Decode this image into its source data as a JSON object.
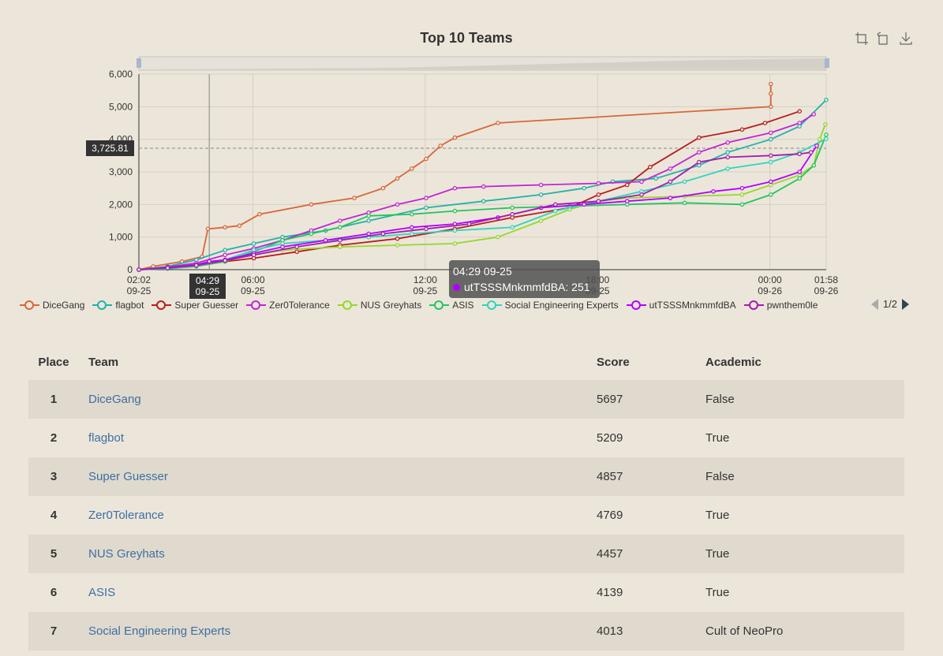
{
  "chart_data": {
    "type": "line",
    "title": "Top 10 Teams",
    "xlabel": "",
    "ylabel": "",
    "ylim": [
      0,
      6000
    ],
    "yticks": [
      "0",
      "1,000",
      "2,000",
      "3,000",
      "4,000",
      "5,000",
      "6,000"
    ],
    "xticks": [
      {
        "time": "02:02",
        "date": "09-25"
      },
      {
        "time": "06:00",
        "date": "09-25"
      },
      {
        "time": "12:00",
        "date": "09-25"
      },
      {
        "time": "18:00",
        "date": "09-25"
      },
      {
        "time": "00:00",
        "date": "09-26"
      },
      {
        "time": "01:58",
        "date": "09-26"
      }
    ],
    "xrange_hours": [
      0,
      23.93
    ],
    "grid": true,
    "legend_position": "bottom",
    "legend_page": "1/2",
    "crosshair": {
      "y_label": "3,725.81",
      "x_label_time": "04:29",
      "x_label_date": "09-25"
    },
    "tooltip": {
      "header": "04:29 09-25",
      "series": "utTSSSMnkmmfdBA",
      "value": "251"
    },
    "series": [
      {
        "name": "DiceGang",
        "color": "#d9663a",
        "points": [
          [
            0,
            0
          ],
          [
            0.5,
            100
          ],
          [
            1.5,
            250
          ],
          [
            2.2,
            400
          ],
          [
            2.4,
            1250
          ],
          [
            3,
            1300
          ],
          [
            3.5,
            1350
          ],
          [
            4.2,
            1700
          ],
          [
            6,
            2000
          ],
          [
            7.5,
            2200
          ],
          [
            8.5,
            2500
          ],
          [
            9,
            2800
          ],
          [
            9.5,
            3100
          ],
          [
            10,
            3400
          ],
          [
            10.5,
            3800
          ],
          [
            11,
            4050
          ],
          [
            12.5,
            4500
          ],
          [
            22,
            5000
          ],
          [
            22,
            5400
          ],
          [
            22,
            5697
          ]
        ]
      },
      {
        "name": "flagbot",
        "color": "#20b2aa",
        "points": [
          [
            0,
            0
          ],
          [
            1,
            100
          ],
          [
            2,
            300
          ],
          [
            3,
            600
          ],
          [
            4,
            800
          ],
          [
            5,
            1000
          ],
          [
            6.5,
            1200
          ],
          [
            8,
            1500
          ],
          [
            10,
            1900
          ],
          [
            12,
            2100
          ],
          [
            14,
            2300
          ],
          [
            15.5,
            2500
          ],
          [
            16.5,
            2700
          ],
          [
            18,
            2800
          ],
          [
            19.5,
            3200
          ],
          [
            20.5,
            3600
          ],
          [
            22,
            4000
          ],
          [
            23,
            4400
          ],
          [
            23.93,
            5209
          ]
        ]
      },
      {
        "name": "Super Guesser",
        "color": "#b91c1c",
        "points": [
          [
            0,
            0
          ],
          [
            1,
            50
          ],
          [
            2,
            150
          ],
          [
            3,
            250
          ],
          [
            4,
            350
          ],
          [
            5.5,
            550
          ],
          [
            7,
            750
          ],
          [
            9,
            950
          ],
          [
            11,
            1250
          ],
          [
            13,
            1600
          ],
          [
            15,
            1900
          ],
          [
            16,
            2300
          ],
          [
            17,
            2600
          ],
          [
            17.8,
            3150
          ],
          [
            19.5,
            4050
          ],
          [
            21,
            4300
          ],
          [
            21.8,
            4500
          ],
          [
            23,
            4857
          ]
        ]
      },
      {
        "name": "Zer0Tolerance",
        "color": "#c026d3",
        "points": [
          [
            0,
            0
          ],
          [
            1,
            80
          ],
          [
            2,
            200
          ],
          [
            3,
            450
          ],
          [
            4,
            650
          ],
          [
            5,
            900
          ],
          [
            6,
            1200
          ],
          [
            7,
            1500
          ],
          [
            8,
            1750
          ],
          [
            9,
            2000
          ],
          [
            10,
            2200
          ],
          [
            11,
            2500
          ],
          [
            12,
            2550
          ],
          [
            14,
            2600
          ],
          [
            16,
            2650
          ],
          [
            17.5,
            2700
          ],
          [
            18.5,
            3100
          ],
          [
            19.5,
            3600
          ],
          [
            20.5,
            3900
          ],
          [
            22,
            4200
          ],
          [
            23,
            4500
          ],
          [
            23.5,
            4769
          ]
        ]
      },
      {
        "name": "NUS Greyhats",
        "color": "#94d82d",
        "points": [
          [
            0,
            0
          ],
          [
            1,
            50
          ],
          [
            2,
            150
          ],
          [
            3,
            300
          ],
          [
            4,
            450
          ],
          [
            5,
            600
          ],
          [
            7,
            700
          ],
          [
            9,
            750
          ],
          [
            11,
            800
          ],
          [
            12.5,
            1000
          ],
          [
            14,
            1500
          ],
          [
            15,
            1850
          ],
          [
            16,
            2100
          ],
          [
            17,
            2200
          ],
          [
            19,
            2250
          ],
          [
            21,
            2300
          ],
          [
            22,
            2600
          ],
          [
            23,
            2900
          ],
          [
            23.5,
            3200
          ],
          [
            23.7,
            4000
          ],
          [
            23.9,
            4457
          ]
        ]
      },
      {
        "name": "ASIS",
        "color": "#22c55e",
        "points": [
          [
            0,
            0
          ],
          [
            1,
            30
          ],
          [
            2,
            100
          ],
          [
            3,
            250
          ],
          [
            4,
            550
          ],
          [
            5,
            900
          ],
          [
            6,
            1100
          ],
          [
            7,
            1300
          ],
          [
            8,
            1650
          ],
          [
            9.5,
            1700
          ],
          [
            11,
            1800
          ],
          [
            13,
            1900
          ],
          [
            15,
            1950
          ],
          [
            17,
            2000
          ],
          [
            19,
            2050
          ],
          [
            21,
            2000
          ],
          [
            22,
            2300
          ],
          [
            23,
            2800
          ],
          [
            23.5,
            3200
          ],
          [
            23.93,
            4139
          ]
        ]
      },
      {
        "name": "Social Engineering Experts",
        "color": "#2dd4bf",
        "points": [
          [
            0,
            0
          ],
          [
            1,
            40
          ],
          [
            2,
            120
          ],
          [
            3,
            300
          ],
          [
            4,
            600
          ],
          [
            5,
            800
          ],
          [
            6.5,
            900
          ],
          [
            8,
            1000
          ],
          [
            9.5,
            1100
          ],
          [
            11,
            1200
          ],
          [
            13,
            1300
          ],
          [
            14.5,
            1800
          ],
          [
            16,
            2100
          ],
          [
            17.5,
            2400
          ],
          [
            19,
            2700
          ],
          [
            20.5,
            3100
          ],
          [
            22,
            3300
          ],
          [
            23,
            3600
          ],
          [
            23.93,
            4013
          ]
        ]
      },
      {
        "name": "utTSSSMnkmmfdBA",
        "color": "#b400ff",
        "points": [
          [
            0,
            0
          ],
          [
            1,
            60
          ],
          [
            2,
            150
          ],
          [
            2.45,
            251
          ],
          [
            3,
            300
          ],
          [
            4,
            500
          ],
          [
            5,
            700
          ],
          [
            6.5,
            900
          ],
          [
            8,
            1100
          ],
          [
            9.5,
            1300
          ],
          [
            11,
            1400
          ],
          [
            12.5,
            1600
          ],
          [
            14,
            1900
          ],
          [
            15.5,
            2000
          ],
          [
            17,
            2100
          ],
          [
            18.5,
            2200
          ],
          [
            20,
            2400
          ],
          [
            21,
            2500
          ],
          [
            22,
            2700
          ],
          [
            23,
            3000
          ],
          [
            23.6,
            3800
          ]
        ]
      },
      {
        "name": "pwnthem0le",
        "color": "#a21caf",
        "points": [
          [
            0,
            0
          ],
          [
            1,
            50
          ],
          [
            2,
            130
          ],
          [
            3,
            280
          ],
          [
            4,
            450
          ],
          [
            5.5,
            700
          ],
          [
            7,
            900
          ],
          [
            8.5,
            1100
          ],
          [
            10,
            1250
          ],
          [
            11.5,
            1400
          ],
          [
            13,
            1700
          ],
          [
            14.5,
            2000
          ],
          [
            16,
            2100
          ],
          [
            17.5,
            2300
          ],
          [
            18.5,
            2700
          ],
          [
            19.5,
            3300
          ],
          [
            20.5,
            3450
          ],
          [
            22,
            3500
          ],
          [
            23,
            3550
          ],
          [
            23.4,
            3600
          ]
        ]
      }
    ]
  },
  "table": {
    "headers": {
      "place": "Place",
      "team": "Team",
      "score": "Score",
      "academic": "Academic"
    },
    "rows": [
      {
        "place": "1",
        "team": "DiceGang",
        "score": "5697",
        "academic": "False"
      },
      {
        "place": "2",
        "team": "flagbot",
        "score": "5209",
        "academic": "True"
      },
      {
        "place": "3",
        "team": "Super Guesser",
        "score": "4857",
        "academic": "False"
      },
      {
        "place": "4",
        "team": "Zer0Tolerance",
        "score": "4769",
        "academic": "True"
      },
      {
        "place": "5",
        "team": "NUS Greyhats",
        "score": "4457",
        "academic": "True"
      },
      {
        "place": "6",
        "team": "ASIS",
        "score": "4139",
        "academic": "True"
      },
      {
        "place": "7",
        "team": "Social Engineering Experts",
        "score": "4013",
        "academic": "Cult of NeoPro"
      }
    ]
  },
  "toolbox": {
    "icons": [
      "zoom-icon",
      "zoom-reset-icon",
      "download-icon"
    ]
  }
}
